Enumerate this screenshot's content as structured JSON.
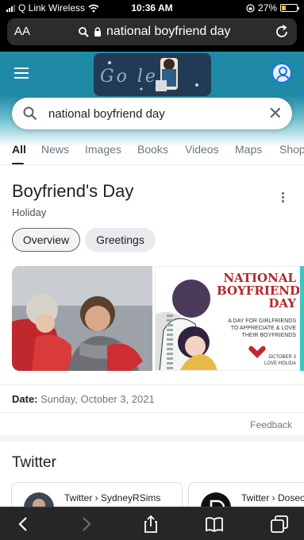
{
  "status_bar": {
    "carrier": "Q Link Wireless",
    "time": "10:36 AM",
    "battery": "27%",
    "battery_level": 0.27,
    "battery_color": "#f4c21b"
  },
  "address_bar": {
    "aa_label": "AA",
    "url_text": "national boyfriend day"
  },
  "search": {
    "query": "national boyfriend day"
  },
  "tabs": [
    {
      "label": "All",
      "active": true
    },
    {
      "label": "News"
    },
    {
      "label": "Images"
    },
    {
      "label": "Books"
    },
    {
      "label": "Videos"
    },
    {
      "label": "Maps"
    },
    {
      "label": "Shop"
    }
  ],
  "knowledge_panel": {
    "title": "Boyfriend's Day",
    "subtitle": "Holiday",
    "chips": [
      "Overview",
      "Greetings"
    ],
    "image2": {
      "title": "NATIONAL BOYFRIEND DAY",
      "text": "A DAY FOR GIRLFRIENDS TO APPRECIATE & LOVE THEIR BOYFRIENDS",
      "date_text": "OCTOBER 3 LOVE HOLIDA"
    },
    "date_label": "Date:",
    "date_value": "Sunday, October 3, 2021",
    "feedback": "Feedback"
  },
  "twitter": {
    "title": "Twitter",
    "cards": [
      {
        "source": "Twitter › SydneyRSims"
      },
      {
        "source": "Twitter › Doseofc"
      }
    ]
  },
  "colors": {
    "accent": "#1a73e8",
    "header_teal": "#1f8aa6",
    "heading_red": "#b5262b"
  }
}
